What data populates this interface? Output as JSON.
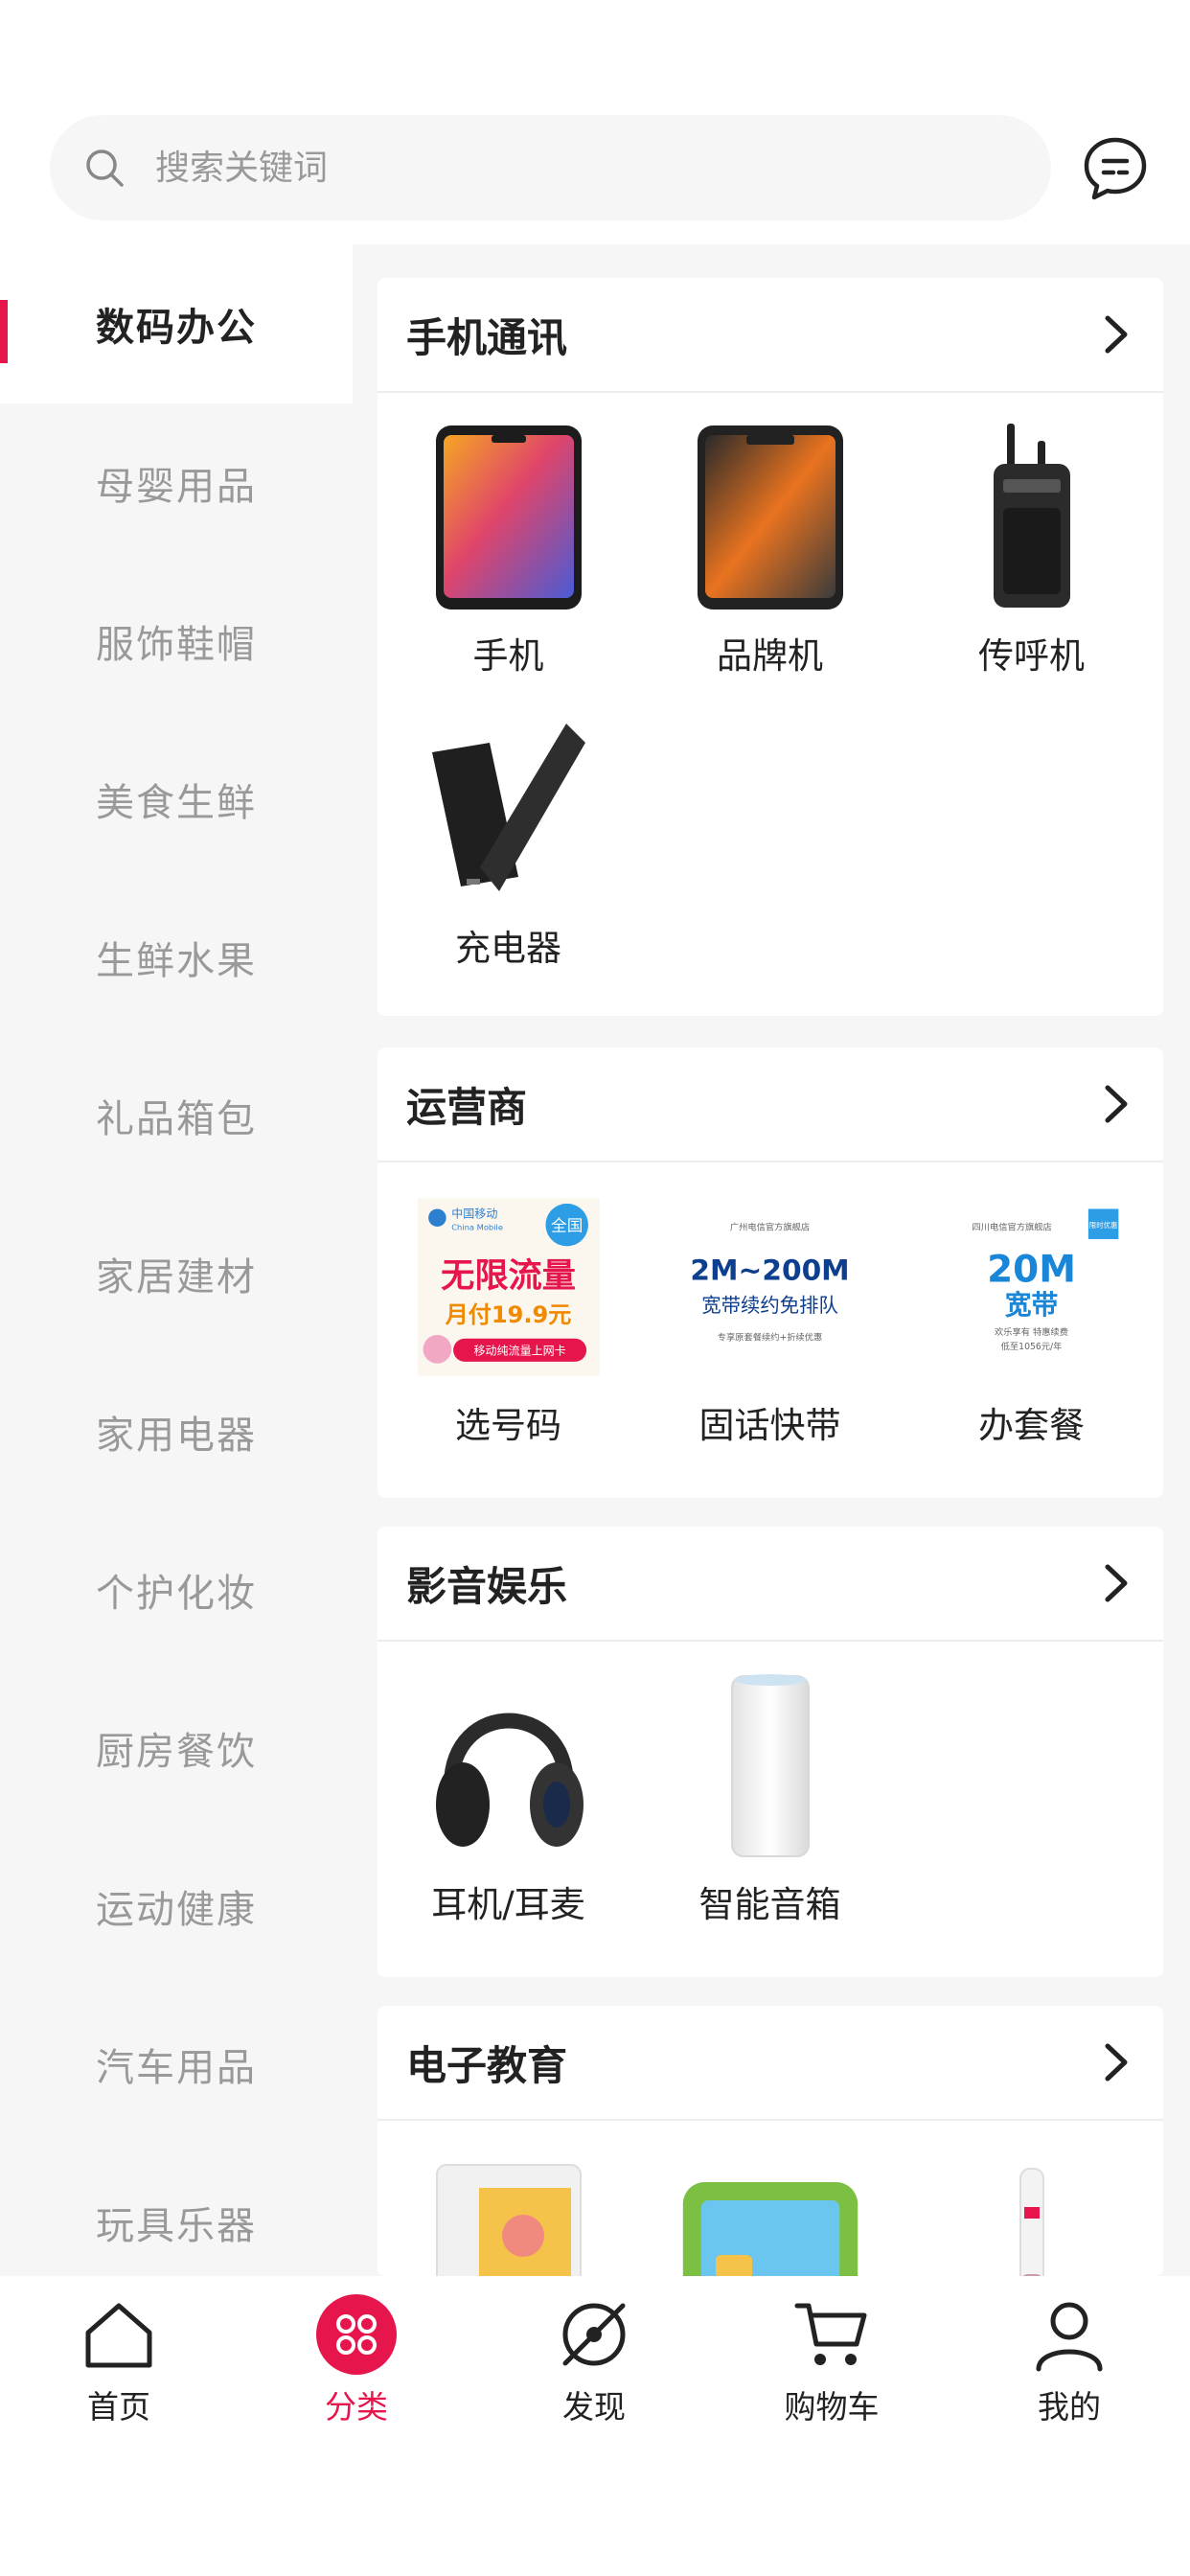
{
  "search": {
    "placeholder": "搜索关键词"
  },
  "sidebar": {
    "items": [
      {
        "label": "数码办公",
        "active": true
      },
      {
        "label": "母婴用品"
      },
      {
        "label": "服饰鞋帽"
      },
      {
        "label": "美食生鲜"
      },
      {
        "label": "生鲜水果"
      },
      {
        "label": "礼品箱包"
      },
      {
        "label": "家居建材"
      },
      {
        "label": "家用电器"
      },
      {
        "label": "个护化妆"
      },
      {
        "label": "厨房餐饮"
      },
      {
        "label": "运动健康"
      },
      {
        "label": "汽车用品"
      },
      {
        "label": "玩具乐器"
      }
    ]
  },
  "sections": [
    {
      "title": "手机通讯",
      "items": [
        "手机",
        "品牌机",
        "传呼机",
        "充电器"
      ]
    },
    {
      "title": "运营商",
      "items": [
        "选号码",
        "固话快带",
        "办套餐"
      ],
      "banners": {
        "b1": {
          "brand": "中国移动",
          "brand_en": "China Mobile",
          "tag": "全国",
          "headline": "无限流量",
          "price": "月付19.9元",
          "foot": "移动纯流量上网卡"
        },
        "b2": {
          "shop": "广州电信官方旗舰店",
          "headline": "2M~200M",
          "sub": "宽带续约免排队",
          "foot": "专享原套餐续约+折续优惠"
        },
        "b3": {
          "shop": "四川电信官方旗舰店",
          "corner": "限时优惠",
          "headline": "20M",
          "sub": "宽带",
          "foot1": "欢乐享有 特惠续费",
          "foot2": "低至1056元/年"
        }
      }
    },
    {
      "title": "影音娱乐",
      "items": [
        "耳机/耳麦",
        "智能音箱"
      ]
    },
    {
      "title": "电子教育",
      "items": []
    }
  ],
  "tabbar": {
    "items": [
      {
        "label": "首页",
        "icon": "home-icon"
      },
      {
        "label": "分类",
        "icon": "category-icon",
        "active": true
      },
      {
        "label": "发现",
        "icon": "discover-icon"
      },
      {
        "label": "购物车",
        "icon": "cart-icon"
      },
      {
        "label": "我的",
        "icon": "user-icon"
      }
    ]
  },
  "colors": {
    "accent": "#e6154c",
    "background": "#f6f6f6",
    "inactive_text": "#999999"
  }
}
